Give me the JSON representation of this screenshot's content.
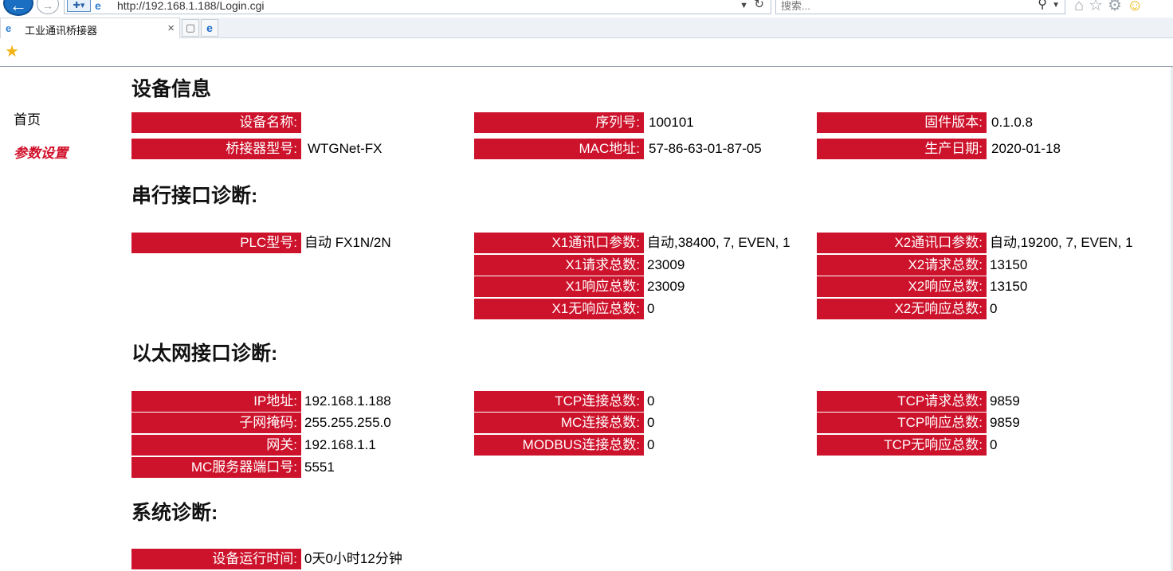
{
  "browser": {
    "url": "http://192.168.1.188/Login.cgi",
    "search_placeholder": "搜索...",
    "tab_title": "工业通讯桥接器"
  },
  "nav": {
    "home": "首页",
    "settings": "参数设置"
  },
  "device_info": {
    "title": "设备信息",
    "device_name_label": "设备名称:",
    "device_name_value": "",
    "serial_label": "序列号:",
    "serial_value": "100101",
    "firmware_label": "固件版本:",
    "firmware_value": "0.1.0.8",
    "bridge_model_label": "桥接器型号:",
    "bridge_model_value": "WTGNet-FX",
    "mac_label": "MAC地址:",
    "mac_value": "57-86-63-01-87-05",
    "prod_date_label": "生产日期:",
    "prod_date_value": "2020-01-18"
  },
  "serial_diag": {
    "title": "串行接口诊断:",
    "plc_label": "PLC型号:",
    "plc_value": "自动 FX1N/2N",
    "x1_params_label": "X1通讯口参数:",
    "x1_params_value": "自动,38400, 7, EVEN, 1",
    "x1_req_label": "X1请求总数:",
    "x1_req_value": "23009",
    "x1_resp_label": "X1响应总数:",
    "x1_resp_value": "23009",
    "x1_noresp_label": "X1无响应总数:",
    "x1_noresp_value": "0",
    "x2_params_label": "X2通讯口参数:",
    "x2_params_value": "自动,19200, 7, EVEN, 1",
    "x2_req_label": "X2请求总数:",
    "x2_req_value": "13150",
    "x2_resp_label": "X2响应总数:",
    "x2_resp_value": "13150",
    "x2_noresp_label": "X2无响应总数:",
    "x2_noresp_value": "0"
  },
  "eth_diag": {
    "title": "以太网接口诊断:",
    "ip_label": "IP地址:",
    "ip_value": "192.168.1.188",
    "mask_label": "子网掩码:",
    "mask_value": "255.255.255.0",
    "gw_label": "网关:",
    "gw_value": "192.168.1.1",
    "mc_port_label": "MC服务器端口号:",
    "mc_port_value": "5551",
    "tcp_conn_label": "TCP连接总数:",
    "tcp_conn_value": "0",
    "mc_conn_label": "MC连接总数:",
    "mc_conn_value": "0",
    "modbus_conn_label": "MODBUS连接总数:",
    "modbus_conn_value": "0",
    "tcp_req_label": "TCP请求总数:",
    "tcp_req_value": "9859",
    "tcp_resp_label": "TCP响应总数:",
    "tcp_resp_value": "9859",
    "tcp_noresp_label": "TCP无响应总数:",
    "tcp_noresp_value": "0"
  },
  "sys_diag": {
    "title": "系统诊断:",
    "uptime_label": "设备运行时间:",
    "uptime_value": "0天0小时12分钟"
  },
  "colors": {
    "label_bg": "#cd122b",
    "label_text": "#ffffff",
    "nav_active": "#d0102a"
  },
  "icons": [
    "back-arrow-icon",
    "forward-arrow-icon",
    "security-shield-icon",
    "ie-icon",
    "refresh-icon",
    "search-icon",
    "home-icon",
    "favorites-star-icon",
    "gear-icon",
    "smiley-icon",
    "close-icon",
    "new-tab-icon",
    "edge-icon"
  ]
}
